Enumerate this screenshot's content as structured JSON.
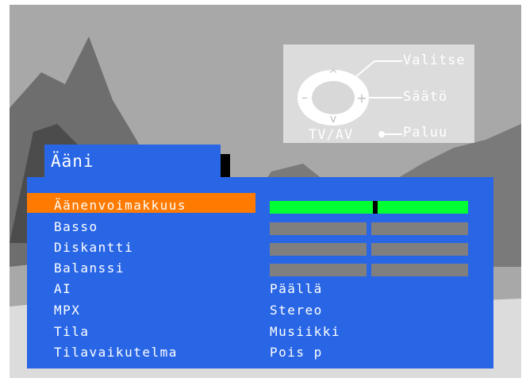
{
  "hint": {
    "select_label": "Valitse",
    "adjust_label": "Säätö",
    "back_label": "Paluu",
    "source_label": "TV/AV"
  },
  "menu": {
    "title": "Ääni",
    "items": [
      {
        "label": "Äänenvoimakkuus",
        "selected": true,
        "level": 0.53
      },
      {
        "label": "Basso",
        "level": 0.5
      },
      {
        "label": "Diskantti",
        "level": 0.5
      },
      {
        "label": "Balanssi",
        "level": 0.5
      },
      {
        "label": "AI",
        "value": "Päällä"
      },
      {
        "label": "MPX",
        "value": "Stereo"
      },
      {
        "label": "Tila",
        "value": "Musiikki"
      },
      {
        "label": "Tilavaikutelma",
        "value": "Pois p"
      }
    ]
  },
  "colors": {
    "panel": "#2966e6",
    "highlight": "#ff7a00",
    "level_active": "#00ff33",
    "level_inactive": "#7f7f7f"
  }
}
